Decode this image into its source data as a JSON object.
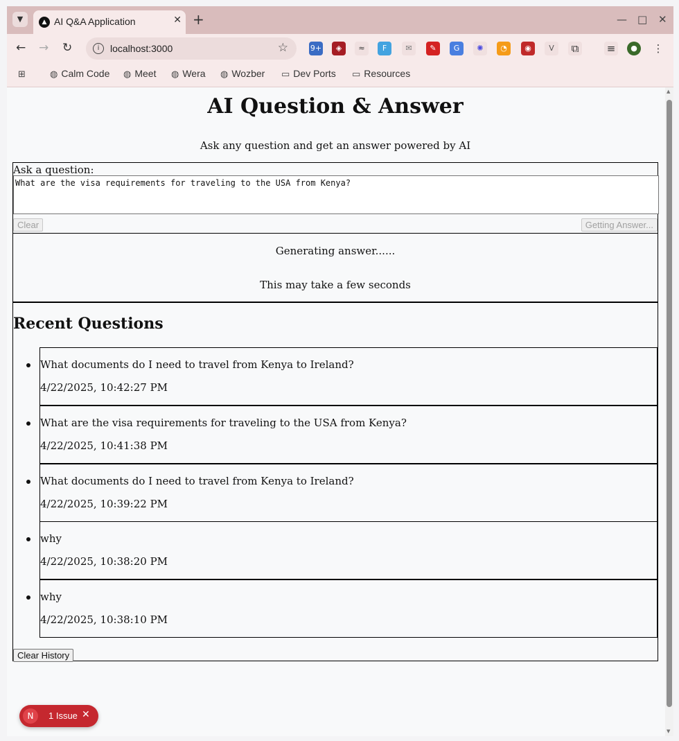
{
  "browser": {
    "tab_title": "AI Q&A Application",
    "url": "localhost:3000",
    "extension_badge": "9+",
    "bookmarks": [
      {
        "label": "Calm Code",
        "icon": "globe-icon"
      },
      {
        "label": "Meet",
        "icon": "globe-icon"
      },
      {
        "label": "Wera",
        "icon": "globe-icon"
      },
      {
        "label": "Wozber",
        "icon": "globe-icon"
      },
      {
        "label": "Dev Ports",
        "icon": "folder-icon"
      },
      {
        "label": "Resources",
        "icon": "folder-icon"
      }
    ]
  },
  "page": {
    "title": "AI Question & Answer",
    "subtitle": "Ask any question and get an answer powered by AI"
  },
  "form": {
    "label": "Ask a question:",
    "question_value": "What are the visa requirements for traveling to the USA from Kenya?",
    "clear_label": "Clear",
    "submit_label": "Getting Answer..."
  },
  "status": {
    "line1": "Generating answer......",
    "line2": "This may take a few seconds"
  },
  "history": {
    "title": "Recent Questions",
    "items": [
      {
        "question": "What documents do I need to travel from Kenya to Ireland?",
        "time": "4/22/2025, 10:42:27 PM"
      },
      {
        "question": "What are the visa requirements for traveling to the USA from Kenya?",
        "time": "4/22/2025, 10:41:38 PM"
      },
      {
        "question": "What documents do I need to travel from Kenya to Ireland?",
        "time": "4/22/2025, 10:39:22 PM"
      },
      {
        "question": "why",
        "time": "4/22/2025, 10:38:20 PM"
      },
      {
        "question": "why",
        "time": "4/22/2025, 10:38:10 PM"
      }
    ],
    "clear_label": "Clear History"
  },
  "devtools": {
    "logo": "N",
    "issue_label": "1 Issue"
  },
  "colors": {
    "titlebar": "#d9bcbc",
    "toolbar": "#f7eaea",
    "issue_badge": "#c5282f"
  }
}
